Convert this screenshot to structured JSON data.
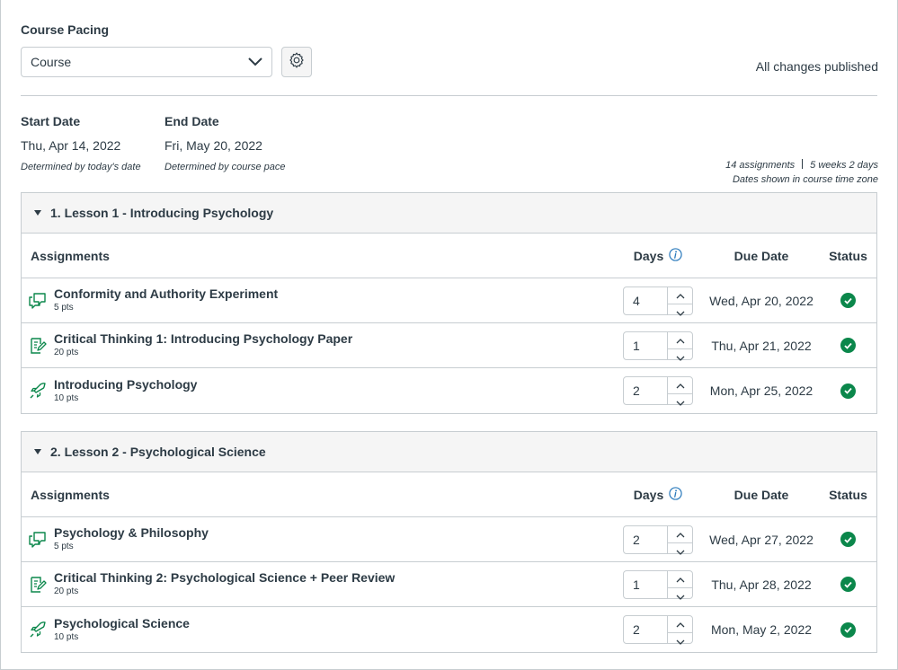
{
  "header": {
    "label": "Course Pacing",
    "select_value": "Course",
    "publish_status": "All changes published"
  },
  "dates": {
    "start_label": "Start Date",
    "start_value": "Thu, Apr 14, 2022",
    "start_note": "Determined by today's date",
    "end_label": "End Date",
    "end_value": "Fri, May 20, 2022",
    "end_note": "Determined by course pace"
  },
  "summary": {
    "assignments": "14 assignments",
    "duration": "5 weeks 2 days",
    "timezone_note": "Dates shown in course time zone"
  },
  "columns": {
    "assignments": "Assignments",
    "days": "Days",
    "due_date": "Due Date",
    "status": "Status"
  },
  "colors": {
    "text": "#2d3b45",
    "border": "#c7cdd1",
    "header_bg": "#f5f5f5",
    "icon_green": "#0b874b",
    "info_blue": "#2b7abc"
  },
  "modules": [
    {
      "title": "1. Lesson 1 - Introducing Psychology",
      "items": [
        {
          "icon": "discussion-icon",
          "title": "Conformity and Authority Experiment",
          "points": "5 pts",
          "days": "4",
          "due": "Wed, Apr 20, 2022"
        },
        {
          "icon": "assignment-icon",
          "title": "Critical Thinking 1: Introducing Psychology Paper",
          "points": "20 pts",
          "days": "1",
          "due": "Thu, Apr 21, 2022"
        },
        {
          "icon": "quiz-icon",
          "title": "Introducing Psychology",
          "points": "10 pts",
          "days": "2",
          "due": "Mon, Apr 25, 2022"
        }
      ]
    },
    {
      "title": "2. Lesson 2 - Psychological Science",
      "items": [
        {
          "icon": "discussion-icon",
          "title": "Psychology & Philosophy",
          "points": "5 pts",
          "days": "2",
          "due": "Wed, Apr 27, 2022"
        },
        {
          "icon": "assignment-icon",
          "title": "Critical Thinking 2: Psychological Science + Peer Review",
          "points": "20 pts",
          "days": "1",
          "due": "Thu, Apr 28, 2022"
        },
        {
          "icon": "quiz-icon",
          "title": "Psychological Science",
          "points": "10 pts",
          "days": "2",
          "due": "Mon, May 2, 2022"
        }
      ]
    }
  ]
}
